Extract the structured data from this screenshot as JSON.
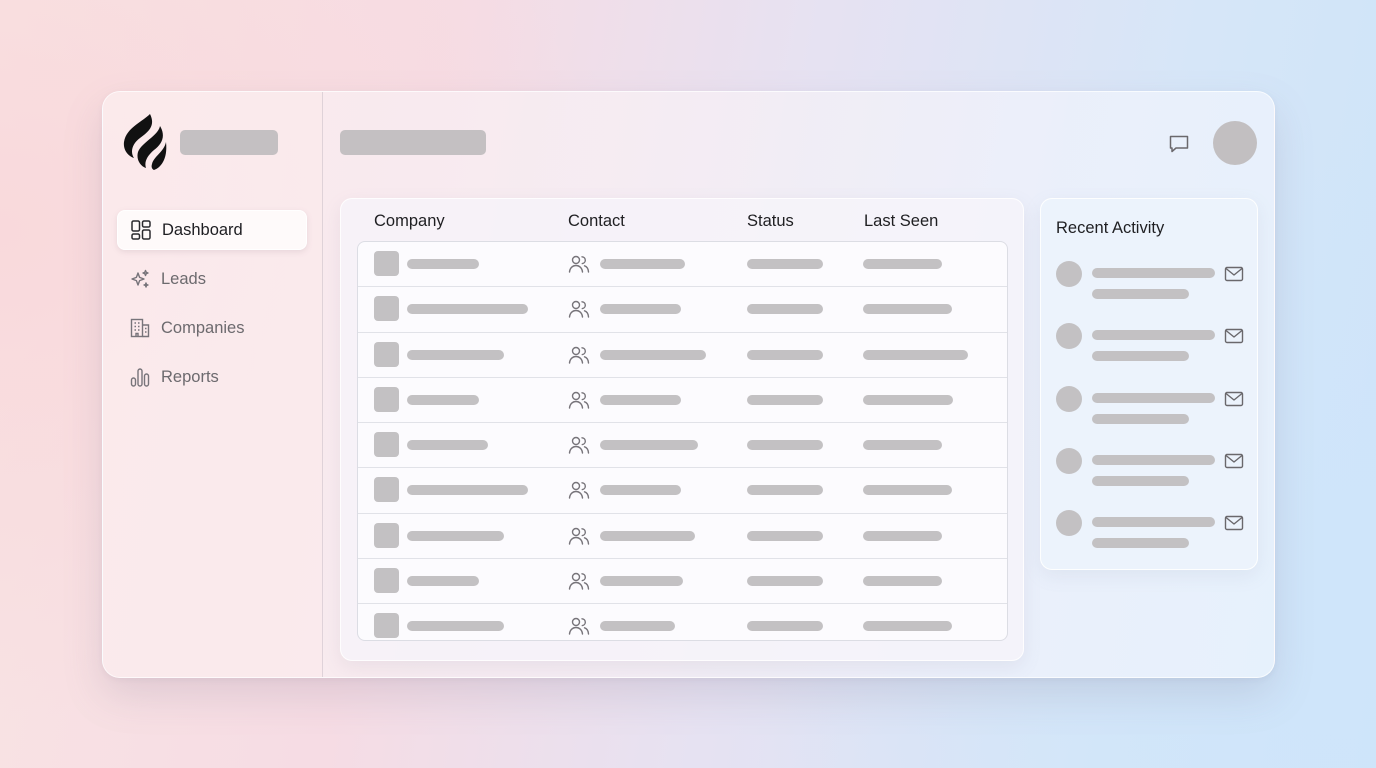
{
  "sidebar": {
    "logo_icon": "flame-logo",
    "items": [
      {
        "label": "Dashboard",
        "icon": "dashboard-grid-icon",
        "active": true
      },
      {
        "label": "Leads",
        "icon": "sparkle-icon",
        "active": false
      },
      {
        "label": "Companies",
        "icon": "building-icon",
        "active": false
      },
      {
        "label": "Reports",
        "icon": "bar-chart-icon",
        "active": false
      }
    ]
  },
  "header": {
    "chat_icon": "chat-bubble-icon",
    "avatar": "user-avatar"
  },
  "table": {
    "columns": [
      "Company",
      "Contact",
      "Status",
      "Last Seen"
    ],
    "row_count": 9,
    "contact_icon": "people-icon"
  },
  "activity": {
    "title": "Recent Activity",
    "item_count": 5,
    "item_icon": "mail-icon"
  },
  "colors": {
    "placeholder": "#c3c1c3",
    "text": "#1f1f22",
    "muted_text": "#6c6a6e"
  }
}
